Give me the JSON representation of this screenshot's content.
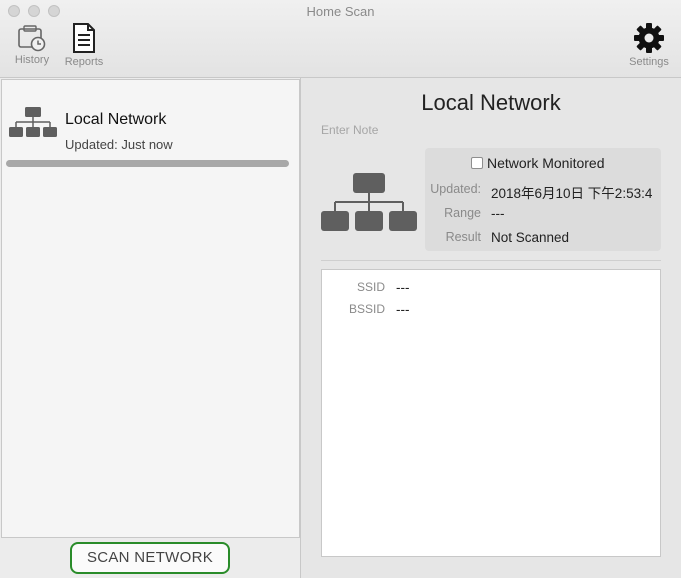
{
  "window": {
    "title": "Home Scan"
  },
  "toolbar": {
    "history_label": "History",
    "reports_label": "Reports",
    "settings_label": "Settings",
    "icons": {
      "history": "calendar-clock-icon",
      "reports": "document-icon",
      "settings": "gear-icon"
    }
  },
  "network_list": {
    "items": [
      {
        "name": "Local Network",
        "updated": "Updated: Just now",
        "icon": "network-topology-icon",
        "progress": 1.0
      }
    ]
  },
  "scan_button_label": "SCAN NETWORK",
  "detail": {
    "title": "Local Network",
    "note_placeholder": "Enter Note",
    "monitored_label": "Network Monitored",
    "monitored_checked": false,
    "updated_label": "Updated:",
    "updated_value": "2018年6月10日 下午2:53:4",
    "range_label": "Range",
    "range_value": "---",
    "result_label": "Result",
    "result_value": "Not Scanned",
    "ssid_label": "SSID",
    "ssid_value": "---",
    "bssid_label": "BSSID",
    "bssid_value": "---"
  },
  "colors": {
    "scan_button_border": "#2a8c2a",
    "icon_gray": "#5f5f5f"
  }
}
